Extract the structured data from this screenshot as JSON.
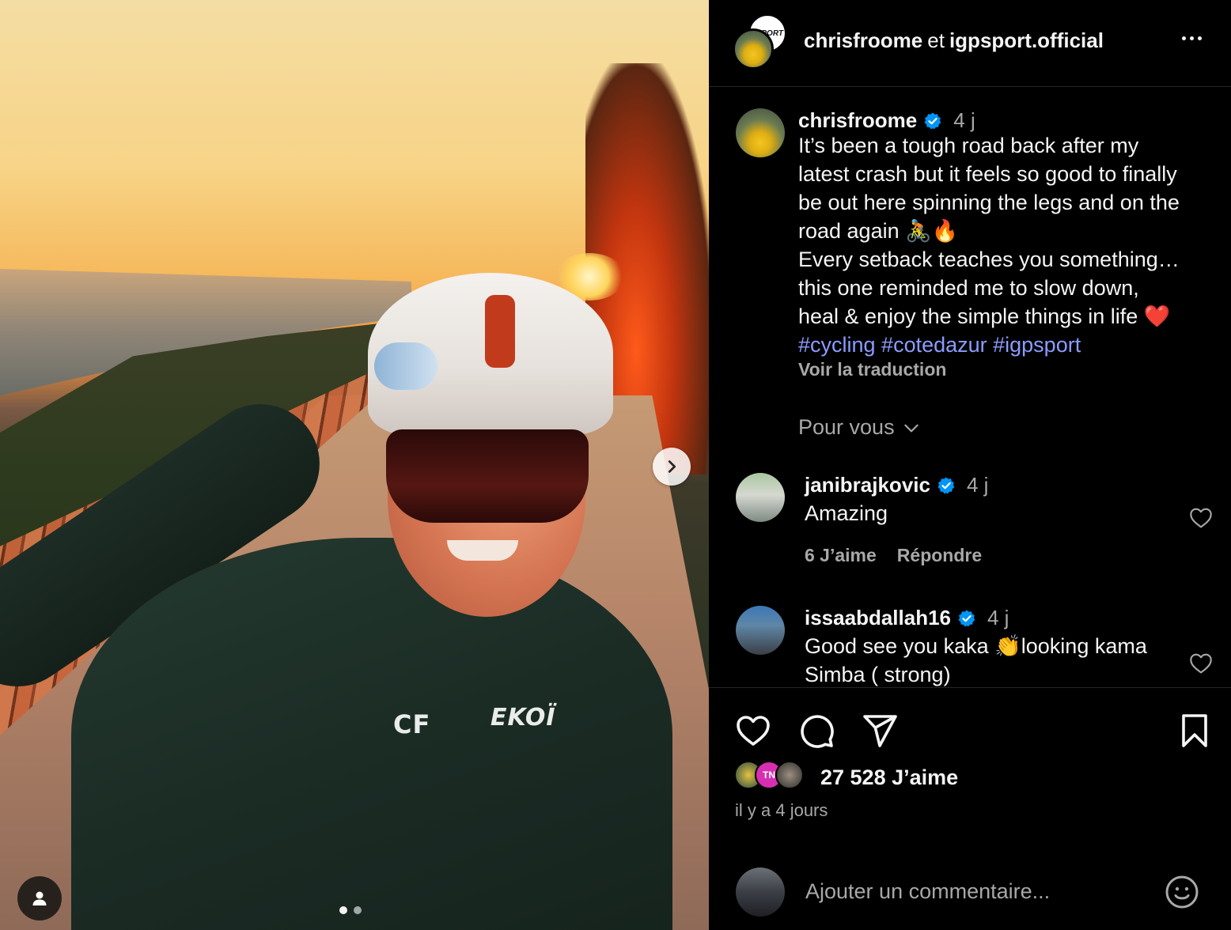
{
  "post": {
    "photo_text": {
      "jersey_initials": "CF",
      "jersey_brand": "EKOÏ"
    },
    "carousel": {
      "total_slides": 2,
      "active_slide": 1
    }
  },
  "header": {
    "user1": "chrisfroome",
    "joiner": "et",
    "user2": "igpsport.official",
    "igp_avatar_text": "SPORT"
  },
  "caption": {
    "username": "chrisfroome",
    "time": "4 j",
    "lines": [
      "It’s been a tough road back after my",
      "latest crash but it feels so good to finally",
      "be out here spinning the legs and on the",
      "road again 🚴🔥",
      "Every setback teaches you something…",
      "this one reminded me to slow down,",
      "heal & enjoy the simple things in life ❤️"
    ],
    "hashtags": "#cycling #cotedazur #igpsport",
    "translate": "Voir la traduction"
  },
  "sort": {
    "label": "Pour vous"
  },
  "comments": [
    {
      "username": "janibrajkovic",
      "time": "4 j",
      "text": "Amazing",
      "likes": "6 J’aime",
      "reply": "Répondre"
    },
    {
      "username": "issaabdallah16",
      "time": "4 j",
      "text_lines": [
        "Good see you kaka 👏looking kama",
        "Simba ( strong)"
      ]
    }
  ],
  "engagement": {
    "likers_badge": "TN",
    "likes": "27 528 J’aime",
    "ago": "il y a 4 jours"
  },
  "add_comment": {
    "placeholder": "Ajouter un commentaire..."
  },
  "colors": {
    "verified": "#0095f6",
    "hashtag": "#8b9cff",
    "secondary_text": "#a8a8a8"
  }
}
